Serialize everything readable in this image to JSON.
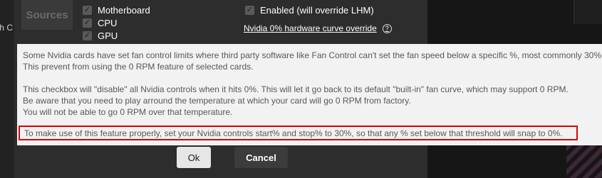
{
  "background": {
    "left_label": "th C"
  },
  "dialog": {
    "sources_tab": "Sources",
    "sensors": [
      {
        "label": "Motherboard",
        "checked": true
      },
      {
        "label": "CPU",
        "checked": true
      },
      {
        "label": "GPU",
        "checked": true
      }
    ],
    "enabled_option": {
      "label": "Enabled (will override LHM)",
      "checked": true
    },
    "link_label": "Nvidia 0% hardware curve override",
    "help_icon": "?",
    "ok_label": "Ok",
    "cancel_label": "Cancel"
  },
  "tooltip": {
    "line1": "Some Nvidia cards have set fan control limits where third party software like Fan Control can't set the fan speed below a specific %, most commonly 30%.",
    "line2": "This prevent from using the 0 RPM feature of selected cards.",
    "line3": "This checkbox will \"disable\" all Nvidia controls when it hits 0%. This will let it go back to its default \"built-in\" fan curve, which may support 0 RPM.",
    "line4": "Be aware that you need to play arround the temperature at which your card will go 0 RPM from factory.",
    "line5": "You will not be able to go 0 RPM over that temperature.",
    "highlighted": "To make use of this feature properly, set your Nvidia controls start% and stop% to 30%, so that any % set below that threshold will snap to 0%."
  },
  "colors": {
    "highlight_border": "#e00000",
    "tooltip_bg": "#f2f2f2",
    "dialog_bg": "#2d2d2d"
  }
}
